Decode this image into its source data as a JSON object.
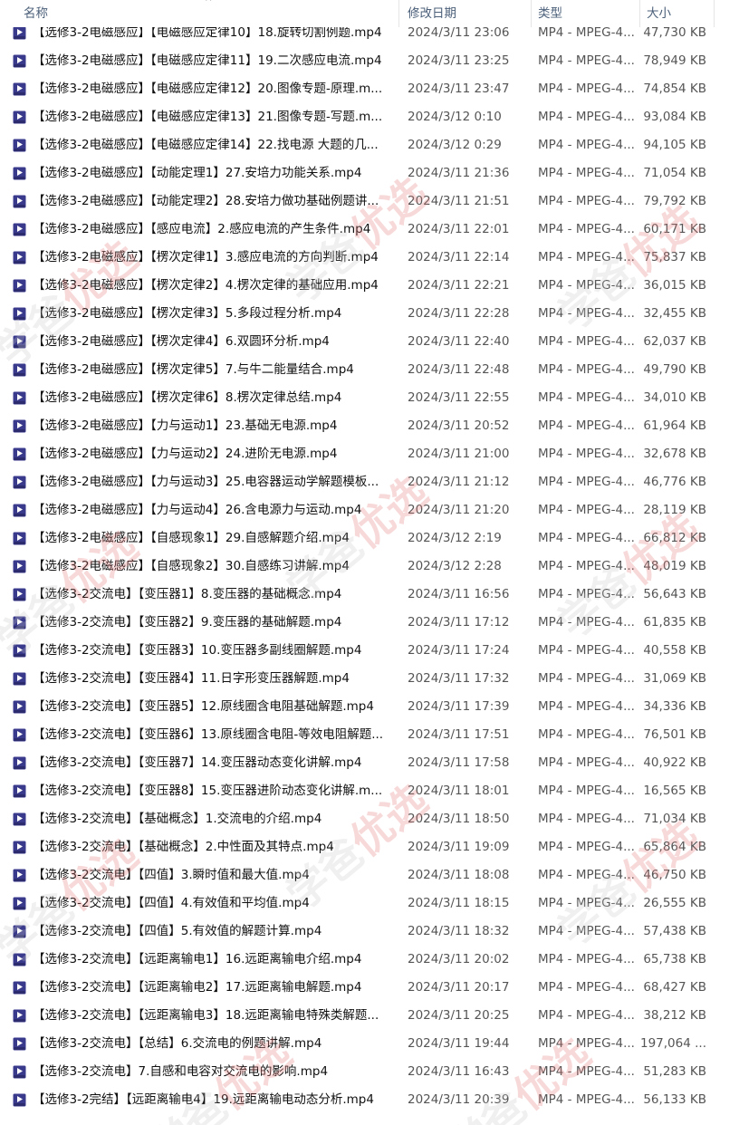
{
  "columns": {
    "name": "名称",
    "date": "修改日期",
    "type": "类型",
    "size": "大小"
  },
  "icon": "mp4-file-icon",
  "watermark": {
    "text_a": "学爸",
    "text_b": "优选"
  },
  "rows": [
    {
      "name": "【选修3-2电磁感应】【电磁感应定律10】18.旋转切割例题.mp4",
      "date": "2024/3/11 23:06",
      "type": "MP4 - MPEG-4...",
      "size": "47,730 KB"
    },
    {
      "name": "【选修3-2电磁感应】【电磁感应定律11】19.二次感应电流.mp4",
      "date": "2024/3/11 23:25",
      "type": "MP4 - MPEG-4...",
      "size": "78,949 KB"
    },
    {
      "name": "【选修3-2电磁感应】【电磁感应定律12】20.图像专题-原理.m...",
      "date": "2024/3/11 23:47",
      "type": "MP4 - MPEG-4...",
      "size": "74,854 KB"
    },
    {
      "name": "【选修3-2电磁感应】【电磁感应定律13】21.图像专题-写题.m...",
      "date": "2024/3/12 0:10",
      "type": "MP4 - MPEG-4...",
      "size": "93,084 KB"
    },
    {
      "name": "【选修3-2电磁感应】【电磁感应定律14】22.找电源 大题的几...",
      "date": "2024/3/12 0:29",
      "type": "MP4 - MPEG-4...",
      "size": "94,105 KB"
    },
    {
      "name": "【选修3-2电磁感应】【动能定理1】27.安培力功能关系.mp4",
      "date": "2024/3/11 21:36",
      "type": "MP4 - MPEG-4...",
      "size": "71,054 KB"
    },
    {
      "name": "【选修3-2电磁感应】【动能定理2】28.安培力做功基础例题讲...",
      "date": "2024/3/11 21:51",
      "type": "MP4 - MPEG-4...",
      "size": "79,792 KB"
    },
    {
      "name": "【选修3-2电磁感应】【感应电流】2.感应电流的产生条件.mp4",
      "date": "2024/3/11 22:01",
      "type": "MP4 - MPEG-4...",
      "size": "60,171 KB"
    },
    {
      "name": "【选修3-2电磁感应】【楞次定律1】3.感应电流的方向判断.mp4",
      "date": "2024/3/11 22:14",
      "type": "MP4 - MPEG-4...",
      "size": "75,837 KB"
    },
    {
      "name": "【选修3-2电磁感应】【楞次定律2】4.楞次定律的基础应用.mp4",
      "date": "2024/3/11 22:21",
      "type": "MP4 - MPEG-4...",
      "size": "36,015 KB"
    },
    {
      "name": "【选修3-2电磁感应】【楞次定律3】5.多段过程分析.mp4",
      "date": "2024/3/11 22:28",
      "type": "MP4 - MPEG-4...",
      "size": "32,455 KB"
    },
    {
      "name": "【选修3-2电磁感应】【楞次定律4】6.双圆环分析.mp4",
      "date": "2024/3/11 22:40",
      "type": "MP4 - MPEG-4...",
      "size": "62,037 KB"
    },
    {
      "name": "【选修3-2电磁感应】【楞次定律5】7.与牛二能量结合.mp4",
      "date": "2024/3/11 22:48",
      "type": "MP4 - MPEG-4...",
      "size": "49,790 KB"
    },
    {
      "name": "【选修3-2电磁感应】【楞次定律6】8.楞次定律总结.mp4",
      "date": "2024/3/11 22:55",
      "type": "MP4 - MPEG-4...",
      "size": "34,010 KB"
    },
    {
      "name": "【选修3-2电磁感应】【力与运动1】23.基础无电源.mp4",
      "date": "2024/3/11 20:52",
      "type": "MP4 - MPEG-4...",
      "size": "61,964 KB"
    },
    {
      "name": "【选修3-2电磁感应】【力与运动2】24.进阶无电源.mp4",
      "date": "2024/3/11 21:00",
      "type": "MP4 - MPEG-4...",
      "size": "32,678 KB"
    },
    {
      "name": "【选修3-2电磁感应】【力与运动3】25.电容器运动学解题模板...",
      "date": "2024/3/11 21:12",
      "type": "MP4 - MPEG-4...",
      "size": "46,776 KB"
    },
    {
      "name": "【选修3-2电磁感应】【力与运动4】26.含电源力与运动.mp4",
      "date": "2024/3/11 21:20",
      "type": "MP4 - MPEG-4...",
      "size": "28,119 KB"
    },
    {
      "name": "【选修3-2电磁感应】【自感现象1】29.自感解题介绍.mp4",
      "date": "2024/3/12 2:19",
      "type": "MP4 - MPEG-4...",
      "size": "66,812 KB"
    },
    {
      "name": "【选修3-2电磁感应】【自感现象2】30.自感练习讲解.mp4",
      "date": "2024/3/12 2:28",
      "type": "MP4 - MPEG-4...",
      "size": "48,019 KB"
    },
    {
      "name": "【选修3-2交流电】【变压器1】8.变压器的基础概念.mp4",
      "date": "2024/3/11 16:56",
      "type": "MP4 - MPEG-4...",
      "size": "56,643 KB"
    },
    {
      "name": "【选修3-2交流电】【变压器2】9.变压器的基础解题.mp4",
      "date": "2024/3/11 17:12",
      "type": "MP4 - MPEG-4...",
      "size": "61,835 KB"
    },
    {
      "name": "【选修3-2交流电】【变压器3】10.变压器多副线圈解题.mp4",
      "date": "2024/3/11 17:24",
      "type": "MP4 - MPEG-4...",
      "size": "40,558 KB"
    },
    {
      "name": "【选修3-2交流电】【变压器4】11.日字形变压器解题.mp4",
      "date": "2024/3/11 17:32",
      "type": "MP4 - MPEG-4...",
      "size": "31,069 KB"
    },
    {
      "name": "【选修3-2交流电】【变压器5】12.原线圈含电阻基础解题.mp4",
      "date": "2024/3/11 17:39",
      "type": "MP4 - MPEG-4...",
      "size": "34,336 KB"
    },
    {
      "name": "【选修3-2交流电】【变压器6】13.原线圈含电阻-等效电阻解题...",
      "date": "2024/3/11 17:51",
      "type": "MP4 - MPEG-4...",
      "size": "76,501 KB"
    },
    {
      "name": "【选修3-2交流电】【变压器7】14.变压器动态变化讲解.mp4",
      "date": "2024/3/11 17:58",
      "type": "MP4 - MPEG-4...",
      "size": "40,922 KB"
    },
    {
      "name": "【选修3-2交流电】【变压器8】15.变压器进阶动态变化讲解.m...",
      "date": "2024/3/11 18:01",
      "type": "MP4 - MPEG-4...",
      "size": "16,565 KB"
    },
    {
      "name": "【选修3-2交流电】【基础概念】1.交流电的介绍.mp4",
      "date": "2024/3/11 18:50",
      "type": "MP4 - MPEG-4...",
      "size": "71,034 KB"
    },
    {
      "name": "【选修3-2交流电】【基础概念】2.中性面及其特点.mp4",
      "date": "2024/3/11 19:09",
      "type": "MP4 - MPEG-4...",
      "size": "65,864 KB"
    },
    {
      "name": "【选修3-2交流电】【四值】3.瞬时值和最大值.mp4",
      "date": "2024/3/11 18:08",
      "type": "MP4 - MPEG-4...",
      "size": "46,750 KB"
    },
    {
      "name": "【选修3-2交流电】【四值】4.有效值和平均值.mp4",
      "date": "2024/3/11 18:15",
      "type": "MP4 - MPEG-4...",
      "size": "26,555 KB"
    },
    {
      "name": "【选修3-2交流电】【四值】5.有效值的解题计算.mp4",
      "date": "2024/3/11 18:32",
      "type": "MP4 - MPEG-4...",
      "size": "57,438 KB"
    },
    {
      "name": "【选修3-2交流电】【远距离输电1】16.远距离输电介绍.mp4",
      "date": "2024/3/11 20:02",
      "type": "MP4 - MPEG-4...",
      "size": "65,738 KB"
    },
    {
      "name": "【选修3-2交流电】【远距离输电2】17.远距离输电解题.mp4",
      "date": "2024/3/11 20:17",
      "type": "MP4 - MPEG-4...",
      "size": "68,427 KB"
    },
    {
      "name": "【选修3-2交流电】【远距离输电3】18.远距离输电特殊类解题...",
      "date": "2024/3/11 20:25",
      "type": "MP4 - MPEG-4...",
      "size": "38,212 KB"
    },
    {
      "name": "【选修3-2交流电】【总结】6.交流电的例题讲解.mp4",
      "date": "2024/3/11 19:44",
      "type": "MP4 - MPEG-4...",
      "size": "197,064 ..."
    },
    {
      "name": "【选修3-2交流电】7.自感和电容对交流电的影响.mp4",
      "date": "2024/3/11 16:43",
      "type": "MP4 - MPEG-4...",
      "size": "51,283 KB"
    },
    {
      "name": "【选修3-2完结】【远距离输电4】19.远距离输电动态分析.mp4",
      "date": "2024/3/11 20:39",
      "type": "MP4 - MPEG-4...",
      "size": "56,133 KB"
    }
  ]
}
